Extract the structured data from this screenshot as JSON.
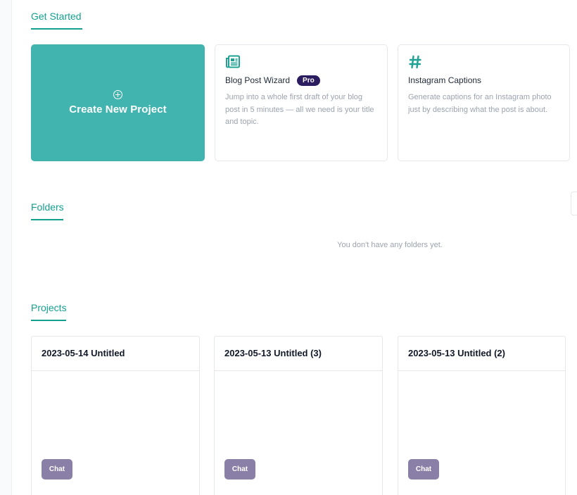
{
  "sections": {
    "get_started": "Get Started",
    "folders": "Folders",
    "projects": "Projects"
  },
  "create_card": {
    "label": "Create New Project",
    "icon": "plus-circle-icon"
  },
  "templates": [
    {
      "icon": "newspaper-icon",
      "title": "Blog Post Wizard",
      "badge": "Pro",
      "description": "Jump into a whole first draft of your blog post in 5 minutes — all we need is your title and topic."
    },
    {
      "icon": "hashtag-icon",
      "title": "Instagram Captions",
      "badge": "",
      "description": "Generate captions for an Instagram photo just by describing what the post is about."
    }
  ],
  "folders": {
    "empty_message": "You don't have any folders yet."
  },
  "projects": [
    {
      "title": "2023-05-14 Untitled",
      "tag": "Chat"
    },
    {
      "title": "2023-05-13 Untitled (3)",
      "tag": "Chat"
    },
    {
      "title": "2023-05-13 Untitled (2)",
      "tag": "Chat"
    }
  ],
  "colors": {
    "accent": "#14a08f",
    "create_card_bg": "#41b4b0",
    "pro_badge": "#2b1d5f",
    "chat_chip": "#8a7fa6"
  }
}
